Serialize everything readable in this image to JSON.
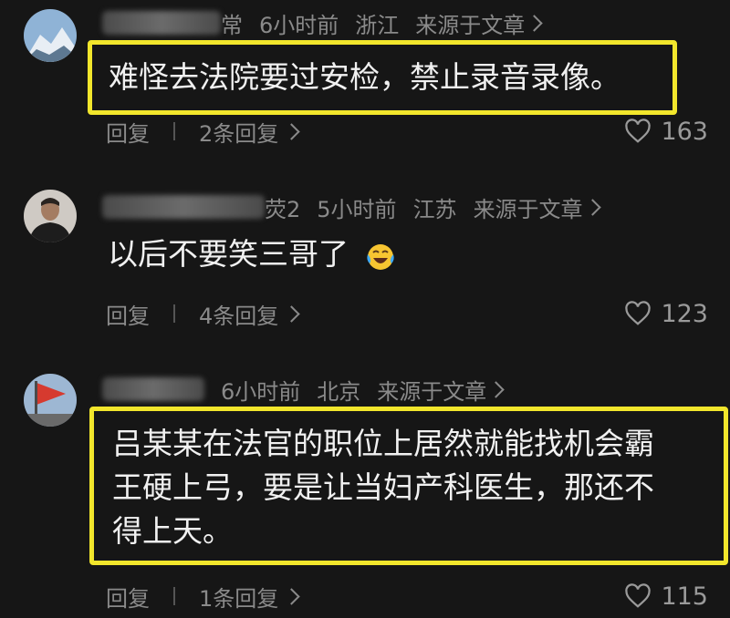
{
  "comments": [
    {
      "name_suffix": "常",
      "time": "6小时前",
      "location": "浙江",
      "source": "来源于文章",
      "text_lines": [
        "难怪去法院要过安检，禁止录音录像。"
      ],
      "reply_label": "回复",
      "reply_count": "2条回复",
      "likes": "163",
      "avatar_icon": "snow-mountain-avatar"
    },
    {
      "name_suffix": "荧2",
      "time": "5小时前",
      "location": "江苏",
      "source": "来源于文章",
      "text_lines": [
        "以后不要笑三哥了"
      ],
      "emoji": "laughing-crying-emoji",
      "reply_label": "回复",
      "reply_count": "4条回复",
      "likes": "123",
      "avatar_icon": "man-portrait-avatar"
    },
    {
      "name_suffix": "",
      "time": "6小时前",
      "location": "北京",
      "source": "来源于文章",
      "text_lines": [
        "吕某某在法官的职位上居然就能找机会霸",
        "王硬上弓，要是让当妇产科医生，那还不",
        "得上天。"
      ],
      "reply_label": "回复",
      "reply_count": "1条回复",
      "likes": "115",
      "avatar_icon": "flag-avatar"
    }
  ],
  "colors": {
    "background": "#161616",
    "highlight": "#f2e62c",
    "meta": "#8a8a8a"
  }
}
